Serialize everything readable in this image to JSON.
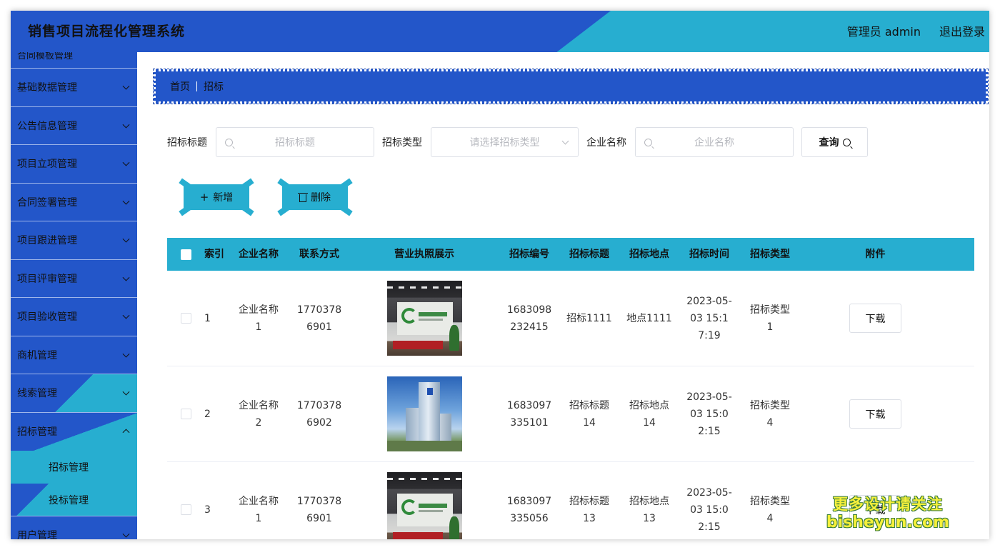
{
  "header": {
    "title": "销售项目流程化管理系统",
    "user": "管理员 admin",
    "logout": "退出登录"
  },
  "sidebar": {
    "top_cut": "合同模板管理",
    "items": [
      {
        "label": "基础数据管理"
      },
      {
        "label": "公告信息管理"
      },
      {
        "label": "项目立项管理"
      },
      {
        "label": "合同签署管理"
      },
      {
        "label": "项目跟进管理"
      },
      {
        "label": "项目评审管理"
      },
      {
        "label": "项目验收管理"
      },
      {
        "label": "商机管理"
      },
      {
        "label": "线索管理"
      },
      {
        "label": "招标管理"
      }
    ],
    "sub_items": [
      {
        "label": "招标管理"
      },
      {
        "label": "投标管理"
      }
    ],
    "bottom": {
      "label": "用户管理"
    }
  },
  "breadcrumb": {
    "home": "首页",
    "current": "招标"
  },
  "search": {
    "title_label": "招标标题",
    "title_placeholder": "招标标题",
    "type_label": "招标类型",
    "type_placeholder": "请选择招标类型",
    "company_label": "企业名称",
    "company_placeholder": "企业名称",
    "query_button": "查询"
  },
  "actions": {
    "add": "新增",
    "delete": "删除"
  },
  "table": {
    "headers": {
      "index": "索引",
      "company": "企业名称",
      "phone": "联系方式",
      "license": "营业执照展示",
      "code": "招标编号",
      "title": "招标标题",
      "location": "招标地点",
      "time": "招标时间",
      "type": "招标类型",
      "attachment": "附件"
    },
    "rows": [
      {
        "index": "1",
        "company": "企业名称1",
        "phone": "17703786901",
        "image": "office",
        "code": "1683098232415",
        "title": "招标1111",
        "location": "地点1111",
        "time": "2023-05-03 15:17:19",
        "type": "招标类型1",
        "download": "下载"
      },
      {
        "index": "2",
        "company": "企业名称2",
        "phone": "17703786902",
        "image": "tower",
        "code": "1683097335101",
        "title": "招标标题14",
        "location": "招标地点14",
        "time": "2023-05-03 15:02:15",
        "type": "招标类型4",
        "download": "下载"
      },
      {
        "index": "3",
        "company": "企业名称1",
        "phone": "17703786901",
        "image": "office",
        "code": "1683097335056",
        "title": "招标标题13",
        "location": "招标地点13",
        "time": "2023-05-03 15:02:15",
        "type": "招标类型4",
        "download": "下载"
      }
    ]
  },
  "watermark": {
    "line1": "更多设计请关注",
    "line2": "bisheyun.com"
  },
  "colors": {
    "primary_blue": "#2356c9",
    "accent_cyan": "#27aed0"
  }
}
